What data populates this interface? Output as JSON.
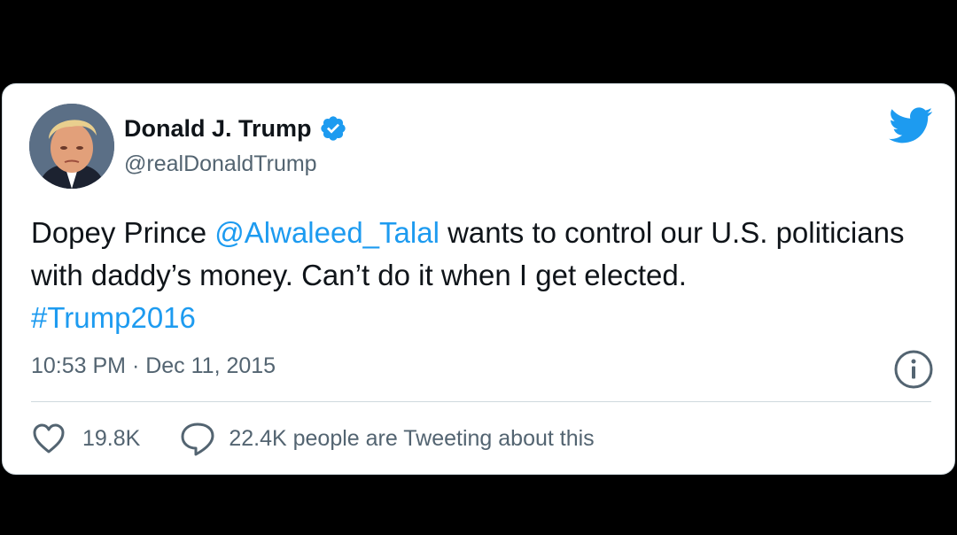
{
  "tweet": {
    "author_name": "Donald J. Trump",
    "author_handle": "@realDonaldTrump",
    "verified": true,
    "text_part1": "Dopey Prince ",
    "mention": "@Alwaleed_Talal",
    "text_part2": " wants to control our U.S. politicians with daddy’s money. Can’t do it when I get elected.",
    "hashtag": "#Trump2016",
    "timestamp": "10:53 PM · Dec 11, 2015",
    "like_count": "19.8K",
    "tweeting_text": "22.4K people are Tweeting about this"
  },
  "icons": {
    "brand": "twitter-bird-icon",
    "verified": "verified-badge-icon",
    "info": "info-icon",
    "like": "heart-icon",
    "reply": "speech-bubble-icon"
  },
  "colors": {
    "link": "#1d9bf0",
    "text": "#0f1419",
    "muted": "#536471",
    "background": "#000000",
    "card": "#ffffff"
  }
}
